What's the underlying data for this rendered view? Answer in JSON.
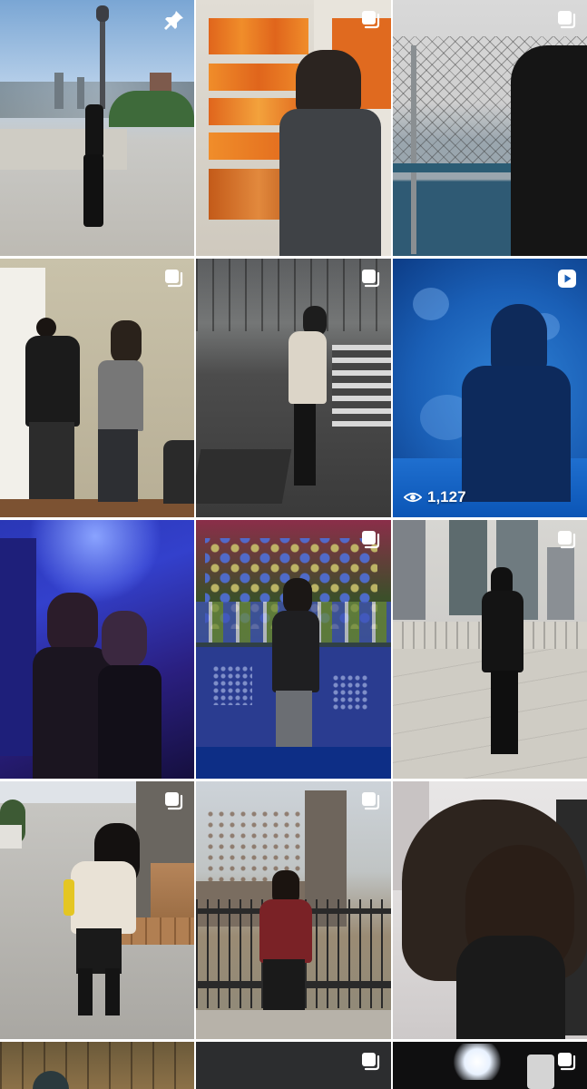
{
  "profile_grid": {
    "overlay_color": "#ffffff",
    "tiles": [
      {
        "index": 1,
        "overlay_icon": "pin-icon",
        "scene": "bridge-lamppost-skyline"
      },
      {
        "index": 2,
        "overlay_icon": "carousel-icon",
        "scene": "snack-shelf"
      },
      {
        "index": 3,
        "overlay_icon": "carousel-icon",
        "scene": "fence-river"
      },
      {
        "index": 4,
        "overlay_icon": "carousel-icon",
        "scene": "two-people-wall"
      },
      {
        "index": 5,
        "overlay_icon": "carousel-icon",
        "scene": "night-crosswalk"
      },
      {
        "index": 6,
        "overlay_icon": "reel-icon",
        "scene": "aquarium-silhouette",
        "view_count": "1,127"
      },
      {
        "index": 7,
        "overlay_icon": "",
        "scene": "purple-light-group"
      },
      {
        "index": 8,
        "overlay_icon": "carousel-icon",
        "scene": "christmas-display"
      },
      {
        "index": 9,
        "overlay_icon": "carousel-icon",
        "scene": "bridge-city"
      },
      {
        "index": 10,
        "overlay_icon": "carousel-icon",
        "scene": "sidewalk-bench"
      },
      {
        "index": 11,
        "overlay_icon": "carousel-icon",
        "scene": "church-fence"
      },
      {
        "index": 12,
        "overlay_icon": "",
        "scene": "close-up-portrait"
      },
      {
        "index": 13,
        "overlay_icon": "",
        "scene": "partial-top-1"
      },
      {
        "index": 14,
        "overlay_icon": "carousel-icon",
        "scene": "partial-top-2"
      },
      {
        "index": 15,
        "overlay_icon": "carousel-icon",
        "scene": "partial-top-3"
      }
    ]
  }
}
